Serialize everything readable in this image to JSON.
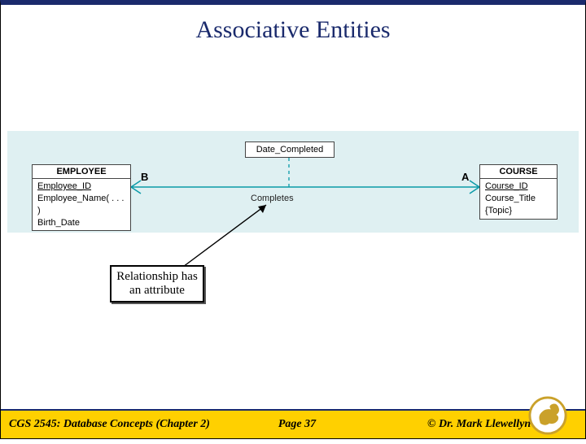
{
  "title": "Associative Entities",
  "diagram": {
    "employee": {
      "name": "EMPLOYEE",
      "attrs": [
        "Employee_ID",
        "Employee_Name( . . . )",
        "Birth_Date"
      ]
    },
    "course": {
      "name": "COURSE",
      "attrs": [
        "Course_ID",
        "Course_Title",
        "{Topic}"
      ]
    },
    "rel_attribute": "Date_Completed",
    "relationship": "Completes",
    "endpointB": "B",
    "endpointA": "A"
  },
  "callout": "Relationship has an attribute",
  "footer": {
    "left": "CGS 2545: Database Concepts  (Chapter 2)",
    "mid": "Page 37",
    "right": "© Dr. Mark Llewellyn"
  }
}
